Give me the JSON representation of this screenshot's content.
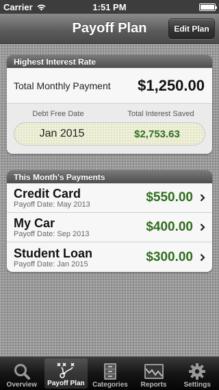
{
  "status_bar": {
    "carrier": "Carrier",
    "time": "1:51 PM"
  },
  "nav": {
    "title": "Payoff Plan",
    "edit_button": "Edit Plan"
  },
  "rate_card": {
    "header": "Highest Interest Rate",
    "monthly_label": "Total Monthly Payment",
    "monthly_value": "$1,250.00",
    "debt_free_label": "Debt Free Date",
    "interest_saved_label": "Total Interest Saved",
    "debt_free_value": "Jan 2015",
    "interest_saved_value": "$2,753.63"
  },
  "payments_card": {
    "header": "This Month's Payments",
    "rows": [
      {
        "name": "Credit Card",
        "payoff": "Payoff Date: May 2013",
        "amount": "$550.00"
      },
      {
        "name": "My Car",
        "payoff": "Payoff Date: Sep 2013",
        "amount": "$400.00"
      },
      {
        "name": "Student Loan",
        "payoff": "Payoff Date: Jan 2015",
        "amount": "$300.00"
      }
    ]
  },
  "tabs": [
    {
      "label": "Overview",
      "icon": "magnifier-icon"
    },
    {
      "label": "Payoff Plan",
      "icon": "playbook-icon",
      "active": true
    },
    {
      "label": "Categories",
      "icon": "filing-cabinet-icon"
    },
    {
      "label": "Reports",
      "icon": "chart-icon"
    },
    {
      "label": "Settings",
      "icon": "gear-icon"
    }
  ],
  "colors": {
    "money_green": "#2f6e1f",
    "header_gray": "#4e4e4e"
  }
}
